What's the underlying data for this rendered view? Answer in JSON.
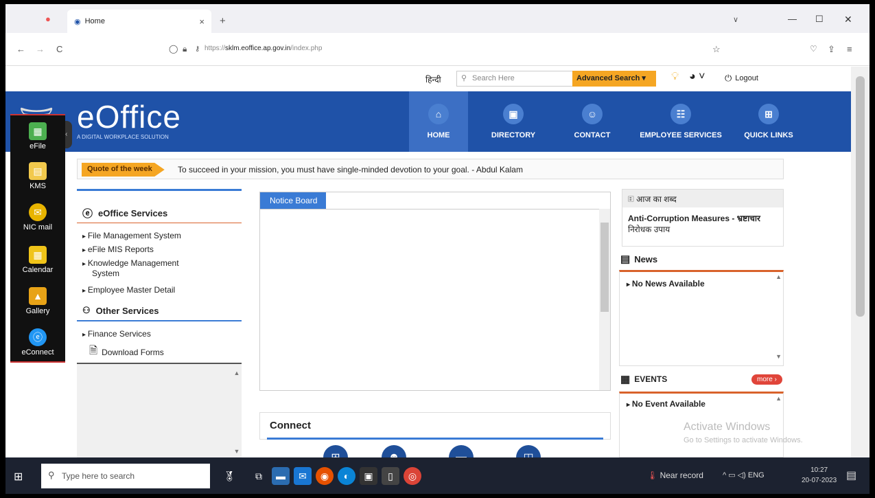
{
  "browser": {
    "tab_title": "Home",
    "tab_close": "×",
    "new_tab": "+",
    "url_prefix": "https://",
    "url_host": "sklm.eoffice.ap.gov.in",
    "url_path": "/index.php",
    "back": "←",
    "forward": "→",
    "reload": "C"
  },
  "topbar": {
    "language": "हिन्दी",
    "search_placeholder": "Search Here",
    "advanced_search": "Advanced Search ▾",
    "logout": "Logout"
  },
  "header": {
    "logo": "eOffice",
    "tagline": "A DIGITAL WORKPLACE SOLUTION",
    "nav": [
      {
        "label": "HOME",
        "icon": "⌂"
      },
      {
        "label": "DIRECTORY",
        "icon": "▣"
      },
      {
        "label": "CONTACT",
        "icon": "☺"
      },
      {
        "label": "EMPLOYEE SERVICES",
        "icon": "☷"
      },
      {
        "label": "QUICK LINKS",
        "icon": "⊞"
      }
    ]
  },
  "quote": {
    "label": "Quote of the week",
    "text": "To succeed in your mission, you must have single-minded devotion to your goal. - Abdul Kalam"
  },
  "dock": [
    {
      "label": "eFile",
      "color": "#4caf50"
    },
    {
      "label": "KMS",
      "color": "#f2c94c"
    },
    {
      "label": "NIC mail",
      "color": "#e8b400"
    },
    {
      "label": "Calendar",
      "color": "#f0c419"
    },
    {
      "label": "Gallery",
      "color": "#e8a317"
    },
    {
      "label": "eConnect",
      "color": "#2196f3"
    }
  ],
  "left_panel": {
    "eoffice_title": "eOffice Services",
    "items": [
      "File Management System",
      "eFile MIS Reports",
      "Knowledge Management",
      "System",
      "Employee Master Detail"
    ],
    "other_title": "Other Services",
    "other_items": [
      "Finance Services"
    ],
    "download": "Download Forms"
  },
  "notice": {
    "title": "Notice Board"
  },
  "connect": {
    "title": "Connect"
  },
  "word": {
    "title": "आज का शब्द",
    "line1": "Anti-Corruption Measures - भ्रष्टाचार",
    "line2": "निरोधक उपाय"
  },
  "news": {
    "title": "News",
    "empty": "No News Available"
  },
  "events": {
    "title": "EVENTS",
    "more": "more ›",
    "empty": "No Event Available"
  },
  "watermark": {
    "line1": "Activate Windows",
    "line2": "Go to Settings to activate Windows."
  },
  "taskbar": {
    "search_placeholder": "Type here to search",
    "weather": "Near record",
    "lang": "ENG",
    "time": "10:27",
    "date": "20-07-2023"
  }
}
